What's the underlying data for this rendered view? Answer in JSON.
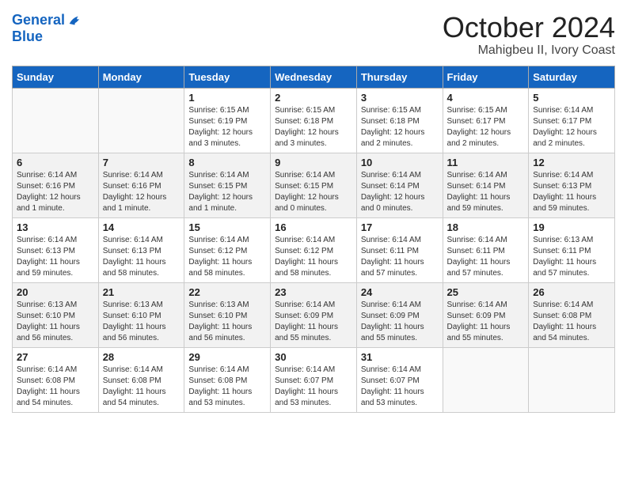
{
  "header": {
    "logo_line1": "General",
    "logo_line2": "Blue",
    "month": "October 2024",
    "location": "Mahigbeu II, Ivory Coast"
  },
  "days_of_week": [
    "Sunday",
    "Monday",
    "Tuesday",
    "Wednesday",
    "Thursday",
    "Friday",
    "Saturday"
  ],
  "weeks": [
    [
      {
        "day": "",
        "info": ""
      },
      {
        "day": "",
        "info": ""
      },
      {
        "day": "1",
        "info": "Sunrise: 6:15 AM\nSunset: 6:19 PM\nDaylight: 12 hours\nand 3 minutes."
      },
      {
        "day": "2",
        "info": "Sunrise: 6:15 AM\nSunset: 6:18 PM\nDaylight: 12 hours\nand 3 minutes."
      },
      {
        "day": "3",
        "info": "Sunrise: 6:15 AM\nSunset: 6:18 PM\nDaylight: 12 hours\nand 2 minutes."
      },
      {
        "day": "4",
        "info": "Sunrise: 6:15 AM\nSunset: 6:17 PM\nDaylight: 12 hours\nand 2 minutes."
      },
      {
        "day": "5",
        "info": "Sunrise: 6:14 AM\nSunset: 6:17 PM\nDaylight: 12 hours\nand 2 minutes."
      }
    ],
    [
      {
        "day": "6",
        "info": "Sunrise: 6:14 AM\nSunset: 6:16 PM\nDaylight: 12 hours\nand 1 minute."
      },
      {
        "day": "7",
        "info": "Sunrise: 6:14 AM\nSunset: 6:16 PM\nDaylight: 12 hours\nand 1 minute."
      },
      {
        "day": "8",
        "info": "Sunrise: 6:14 AM\nSunset: 6:15 PM\nDaylight: 12 hours\nand 1 minute."
      },
      {
        "day": "9",
        "info": "Sunrise: 6:14 AM\nSunset: 6:15 PM\nDaylight: 12 hours\nand 0 minutes."
      },
      {
        "day": "10",
        "info": "Sunrise: 6:14 AM\nSunset: 6:14 PM\nDaylight: 12 hours\nand 0 minutes."
      },
      {
        "day": "11",
        "info": "Sunrise: 6:14 AM\nSunset: 6:14 PM\nDaylight: 11 hours\nand 59 minutes."
      },
      {
        "day": "12",
        "info": "Sunrise: 6:14 AM\nSunset: 6:13 PM\nDaylight: 11 hours\nand 59 minutes."
      }
    ],
    [
      {
        "day": "13",
        "info": "Sunrise: 6:14 AM\nSunset: 6:13 PM\nDaylight: 11 hours\nand 59 minutes."
      },
      {
        "day": "14",
        "info": "Sunrise: 6:14 AM\nSunset: 6:13 PM\nDaylight: 11 hours\nand 58 minutes."
      },
      {
        "day": "15",
        "info": "Sunrise: 6:14 AM\nSunset: 6:12 PM\nDaylight: 11 hours\nand 58 minutes."
      },
      {
        "day": "16",
        "info": "Sunrise: 6:14 AM\nSunset: 6:12 PM\nDaylight: 11 hours\nand 58 minutes."
      },
      {
        "day": "17",
        "info": "Sunrise: 6:14 AM\nSunset: 6:11 PM\nDaylight: 11 hours\nand 57 minutes."
      },
      {
        "day": "18",
        "info": "Sunrise: 6:14 AM\nSunset: 6:11 PM\nDaylight: 11 hours\nand 57 minutes."
      },
      {
        "day": "19",
        "info": "Sunrise: 6:13 AM\nSunset: 6:11 PM\nDaylight: 11 hours\nand 57 minutes."
      }
    ],
    [
      {
        "day": "20",
        "info": "Sunrise: 6:13 AM\nSunset: 6:10 PM\nDaylight: 11 hours\nand 56 minutes."
      },
      {
        "day": "21",
        "info": "Sunrise: 6:13 AM\nSunset: 6:10 PM\nDaylight: 11 hours\nand 56 minutes."
      },
      {
        "day": "22",
        "info": "Sunrise: 6:13 AM\nSunset: 6:10 PM\nDaylight: 11 hours\nand 56 minutes."
      },
      {
        "day": "23",
        "info": "Sunrise: 6:14 AM\nSunset: 6:09 PM\nDaylight: 11 hours\nand 55 minutes."
      },
      {
        "day": "24",
        "info": "Sunrise: 6:14 AM\nSunset: 6:09 PM\nDaylight: 11 hours\nand 55 minutes."
      },
      {
        "day": "25",
        "info": "Sunrise: 6:14 AM\nSunset: 6:09 PM\nDaylight: 11 hours\nand 55 minutes."
      },
      {
        "day": "26",
        "info": "Sunrise: 6:14 AM\nSunset: 6:08 PM\nDaylight: 11 hours\nand 54 minutes."
      }
    ],
    [
      {
        "day": "27",
        "info": "Sunrise: 6:14 AM\nSunset: 6:08 PM\nDaylight: 11 hours\nand 54 minutes."
      },
      {
        "day": "28",
        "info": "Sunrise: 6:14 AM\nSunset: 6:08 PM\nDaylight: 11 hours\nand 54 minutes."
      },
      {
        "day": "29",
        "info": "Sunrise: 6:14 AM\nSunset: 6:08 PM\nDaylight: 11 hours\nand 53 minutes."
      },
      {
        "day": "30",
        "info": "Sunrise: 6:14 AM\nSunset: 6:07 PM\nDaylight: 11 hours\nand 53 minutes."
      },
      {
        "day": "31",
        "info": "Sunrise: 6:14 AM\nSunset: 6:07 PM\nDaylight: 11 hours\nand 53 minutes."
      },
      {
        "day": "",
        "info": ""
      },
      {
        "day": "",
        "info": ""
      }
    ]
  ]
}
